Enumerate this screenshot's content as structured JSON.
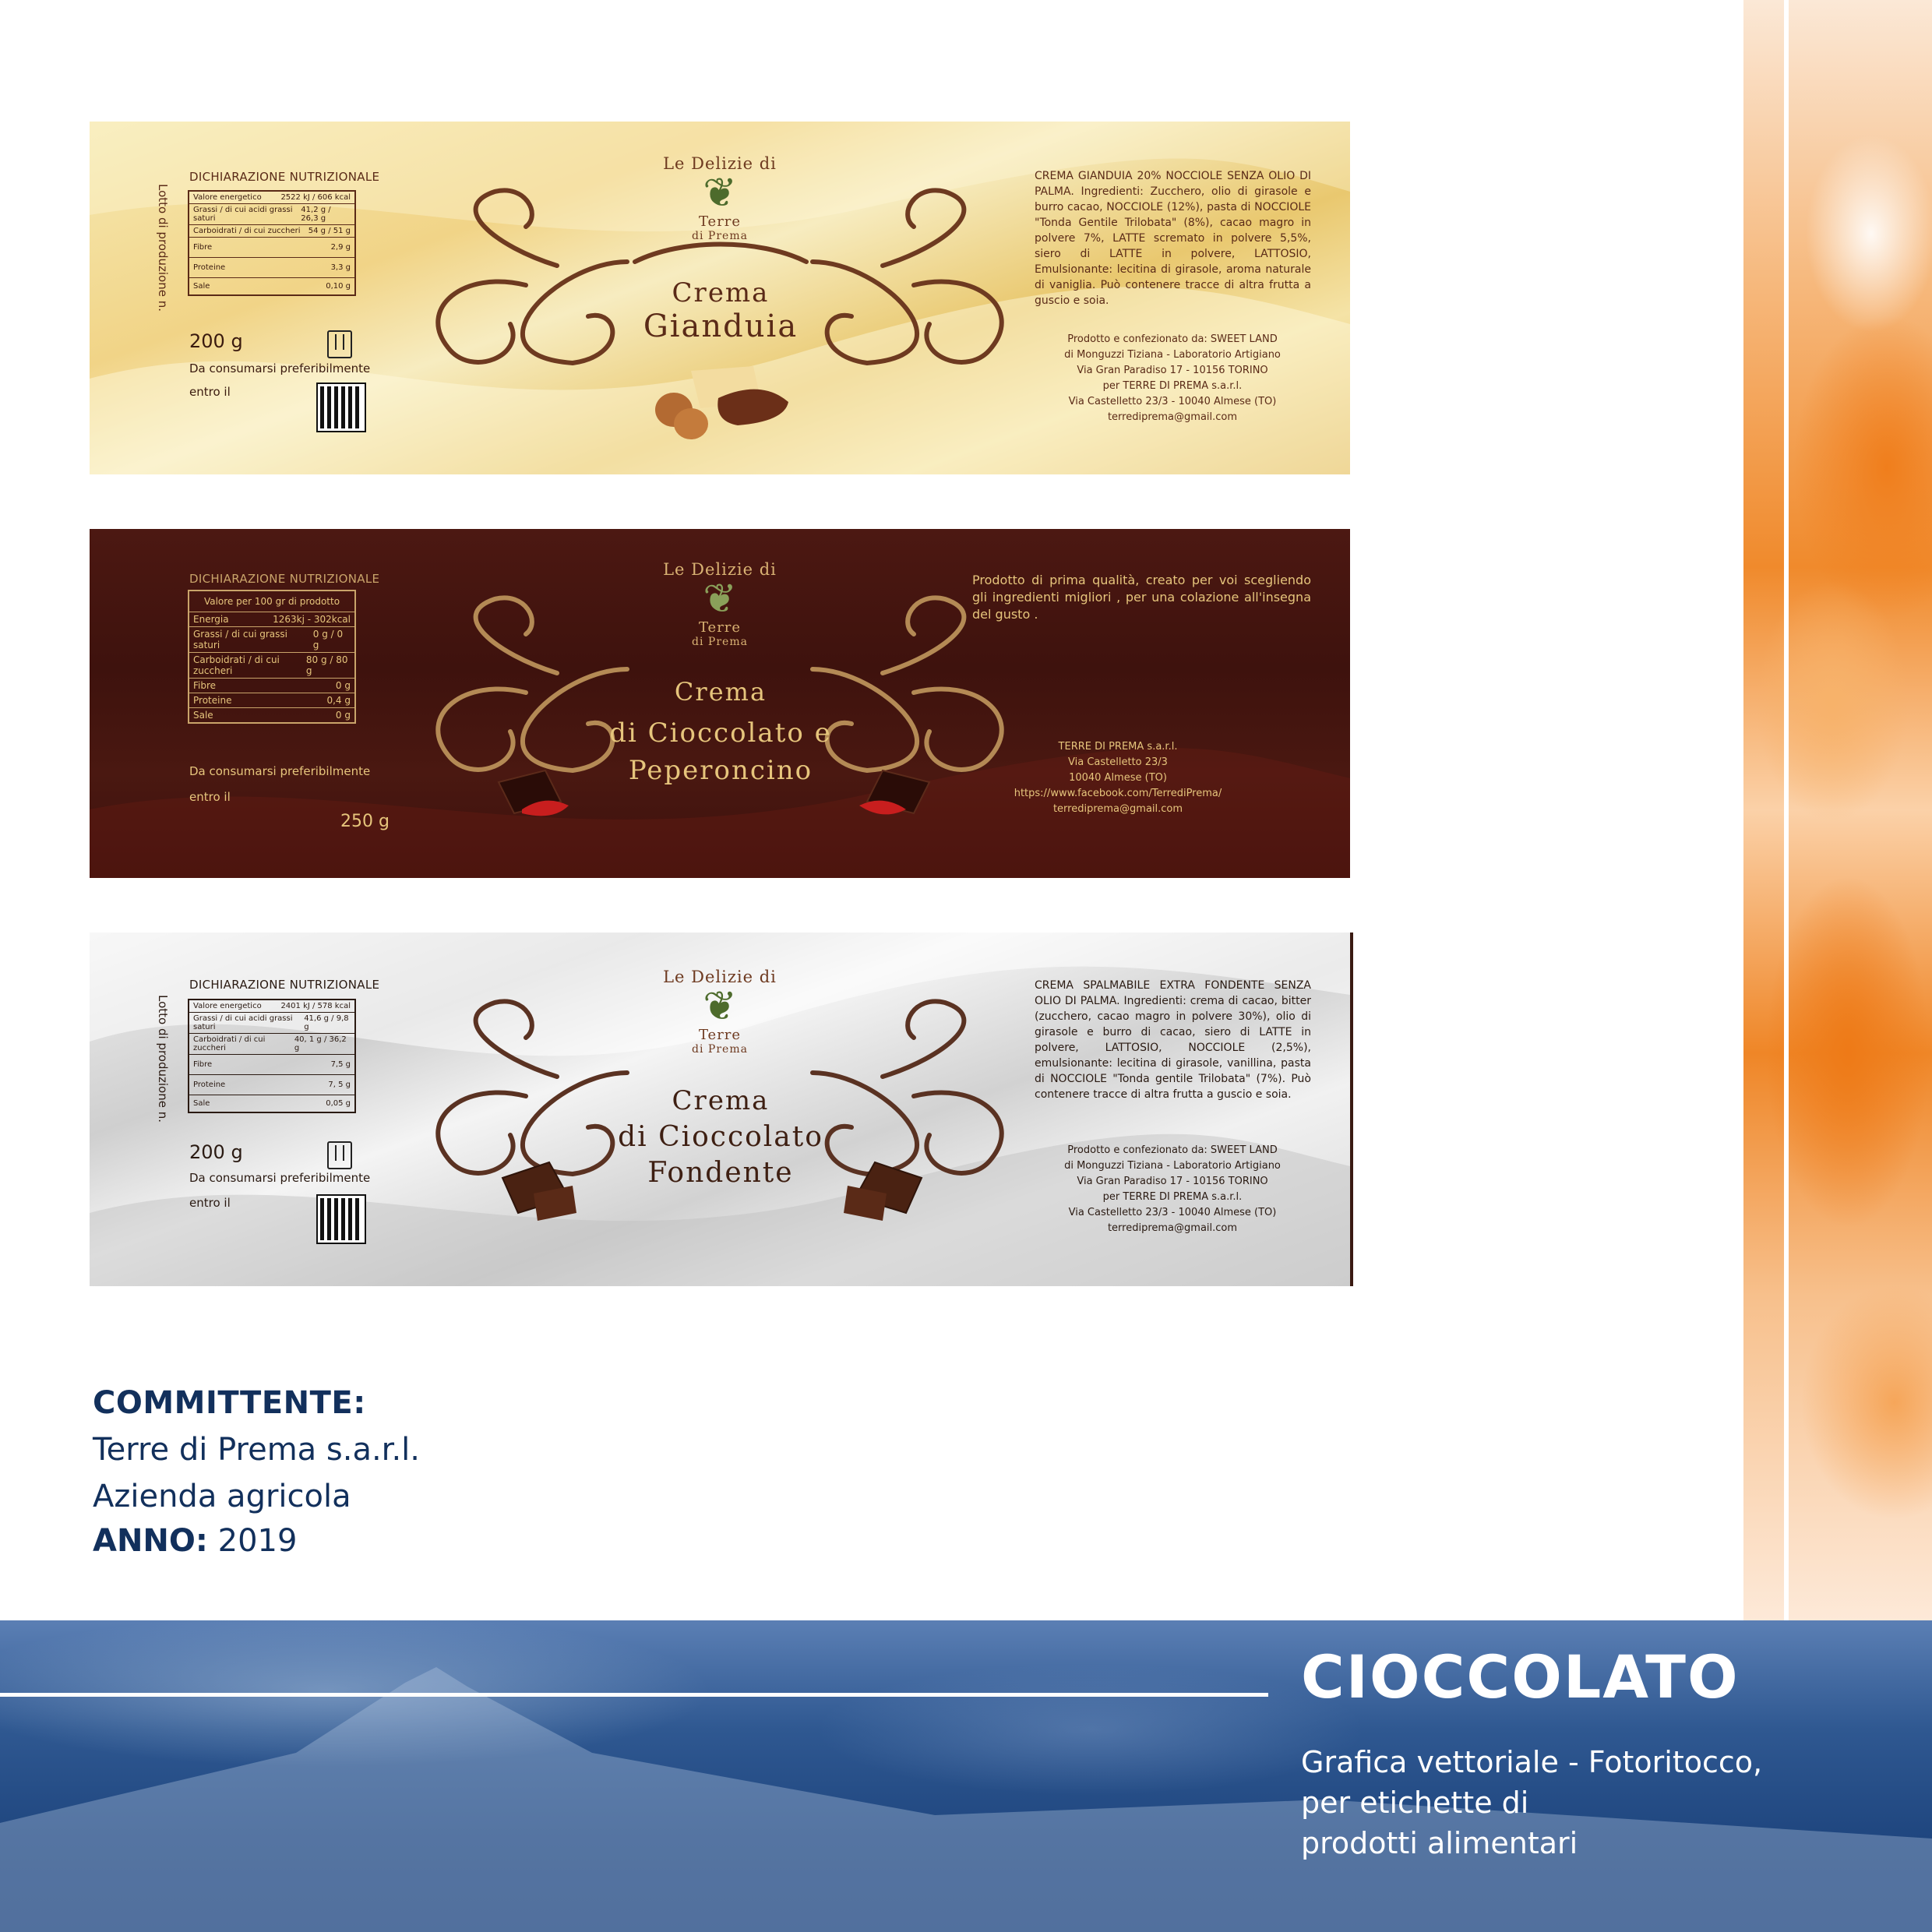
{
  "colors": {
    "navy": "#12305c",
    "brown": "#5a2a17",
    "gold_text": "#e6c57c",
    "label1_bg": "#f1d487",
    "label2_bg": "#3e120d",
    "label3_bg": "#d8d8d8",
    "orange": "#f08a2c",
    "blue_band": "#1f467f"
  },
  "labels": [
    {
      "nutrition_title": "DICHIARAZIONE NUTRIZIONALE",
      "nutrition_rows": [
        {
          "name": "Valore energetico",
          "value": "2522 kJ / 606 kcal"
        },
        {
          "name": "Grassi / di cui acidi grassi saturi",
          "value": "41,2 g / 26,3 g"
        },
        {
          "name": "Carboidrati / di cui zuccheri",
          "value": "54 g / 51 g"
        },
        {
          "name": "Fibre",
          "value": "2,9 g"
        },
        {
          "name": "Proteine",
          "value": "3,3 g"
        },
        {
          "name": "Sale",
          "value": "0,10 g"
        }
      ],
      "lotto": "Lotto di produzione n.",
      "weight": "200 g",
      "consumarsi": "Da consumarsi preferibilmente",
      "entro": "entro il",
      "logo_top": "Le Delizie di",
      "logo_terre": "Terre",
      "logo_prema": "di Prema",
      "title": "Crema",
      "subtitle": "Gianduia",
      "ingredients": "CREMA GIANDUIA 20% NOCCIOLE SENZA OLIO DI PALMA. Ingredienti: Zucchero, olio di girasole e burro cacao, NOCCIOLE (12%), pasta di NOCCIOLE \"Tonda Gentile Trilobata\" (8%), cacao magro in polvere 7%, LATTE scremato in polvere 5,5%, siero di LATTE in polvere, LATTOSIO, Emulsionante: lecitina di girasole, aroma naturale di vaniglia. Può contenere tracce di altra frutta a guscio e soia.",
      "producer": [
        "Prodotto e confezionato da: SWEET LAND",
        "di Monguzzi Tiziana - Laboratorio Artigiano",
        "Via Gran Paradiso 17 - 10156 TORINO",
        "per TERRE DI PREMA s.a.r.l.",
        "Via Castelletto 23/3 - 10040 Almese (TO)",
        "terrediprema@gmail.com"
      ]
    },
    {
      "nutrition_title": "DICHIARAZIONE NUTRIZIONALE",
      "nutrition_header": "Valore per 100 gr di prodotto",
      "nutrition_rows": [
        {
          "name": "Energia",
          "value": "1263kj - 302kcal"
        },
        {
          "name": "Grassi / di cui grassi saturi",
          "value": "0 g / 0 g"
        },
        {
          "name": "Carboidrati / di cui zuccheri",
          "value": "80 g / 80 g"
        },
        {
          "name": "Fibre",
          "value": "0 g"
        },
        {
          "name": "Proteine",
          "value": "0,4 g"
        },
        {
          "name": "Sale",
          "value": "0 g"
        }
      ],
      "consumarsi": "Da consumarsi preferibilmente",
      "entro": "entro il",
      "weight": "250 g",
      "logo_top": "Le Delizie di",
      "logo_terre": "Terre",
      "logo_prema": "di Prema",
      "title": "Crema",
      "subtitle": "di Cioccolato e",
      "subtitle2": "Peperoncino",
      "description": "Prodotto di prima qualità, creato per voi scegliendo gli ingredienti migliori , per una colazione all'insegna del gusto .",
      "producer": [
        "TERRE DI PREMA s.a.r.l.",
        "Via Castelletto 23/3",
        "10040 Almese (TO)",
        "https://www.facebook.com/TerrediPrema/",
        "terrediprema@gmail.com"
      ]
    },
    {
      "nutrition_title": "DICHIARAZIONE NUTRIZIONALE",
      "nutrition_rows": [
        {
          "name": "Valore energetico",
          "value": "2401 kJ / 578 kcal"
        },
        {
          "name": "Grassi / di cui acidi grassi saturi",
          "value": "41,6 g / 9,8 g"
        },
        {
          "name": "Carboidrati / di cui zuccheri",
          "value": "40, 1 g / 36,2 g"
        },
        {
          "name": "Fibre",
          "value": "7,5 g"
        },
        {
          "name": "Proteine",
          "value": "7, 5 g"
        },
        {
          "name": "Sale",
          "value": "0,05 g"
        }
      ],
      "lotto": "Lotto di produzione n.",
      "weight": "200 g",
      "consumarsi": "Da consumarsi preferibilmente",
      "entro": "entro il",
      "logo_top": "Le Delizie di",
      "logo_terre": "Terre",
      "logo_prema": "di Prema",
      "title": "Crema",
      "subtitle": "di Cioccolato",
      "subtitle2": "Fondente",
      "ingredients": "CREMA SPALMABILE EXTRA FONDENTE SENZA OLIO DI PALMA. Ingredienti: crema di cacao, bitter (zucchero, cacao magro in polvere 30%), olio di girasole e burro di cacao, siero di LATTE in polvere, LATTOSIO, NOCCIOLE (2,5%), emulsionante: lecitina di girasole, vanillina, pasta di NOCCIOLE \"Tonda gentile Trilobata\" (7%). Può contenere tracce di altra frutta a guscio e soia.",
      "producer": [
        "Prodotto e confezionato da: SWEET LAND",
        "di Monguzzi Tiziana - Laboratorio Artigiano",
        "Via Gran Paradiso 17 - 10156 TORINO",
        "per TERRE DI PREMA s.a.r.l.",
        "Via Castelletto 23/3 - 10040 Almese (TO)",
        "terrediprema@gmail.com"
      ]
    }
  ],
  "info": {
    "committente_label": "COMMITTENTE:",
    "client_line1": "Terre di Prema s.a.r.l.",
    "client_line2": "Azienda agricola",
    "anno_label": "ANNO:",
    "anno_value": "2019"
  },
  "section": {
    "title": "CIOCCOLATO",
    "desc_line1": "Grafica vettoriale - Fotoritocco,",
    "desc_line2": "per etichette di",
    "desc_line3": "prodotti alimentari"
  },
  "icons": {
    "bin": "recycle-bin-icon",
    "qr": "qr-code-icon",
    "tree": "tree-logo-icon"
  }
}
